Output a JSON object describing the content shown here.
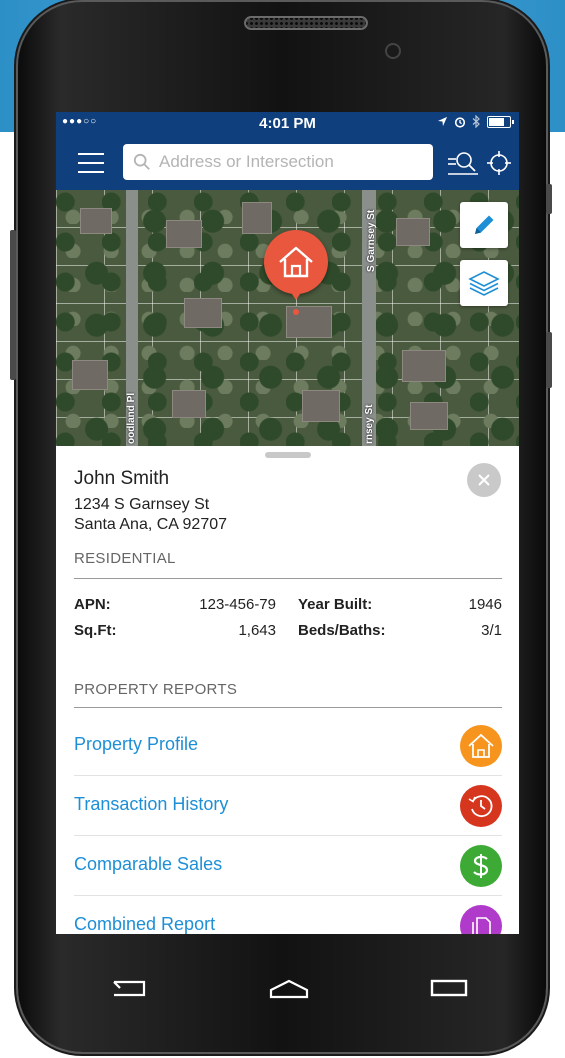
{
  "status_bar": {
    "signal": "●●●○○",
    "time": "4:01 PM",
    "icons": [
      "location-arrow-icon",
      "alarm-icon",
      "bluetooth-icon",
      "battery-icon"
    ]
  },
  "navbar": {
    "search_placeholder": "Address or Intersection",
    "icons": [
      "menu-icon",
      "search-area-icon",
      "locate-icon"
    ]
  },
  "map": {
    "streets": [
      "S Garnsey St",
      "oodland Pl",
      "rnsey St"
    ],
    "buttons": [
      "edit-pencil-icon",
      "layers-icon"
    ],
    "pin_icon": "house-icon"
  },
  "property": {
    "owner": "John Smith",
    "address_line1": "1234 S Garnsey St",
    "address_line2": "Santa Ana, CA 92707",
    "type": "RESIDENTIAL",
    "apn_label": "APN:",
    "apn": "123-456-79",
    "year_label": "Year Built:",
    "year": "1946",
    "sqft_label": "Sq.Ft:",
    "sqft": "1,643",
    "beds_label": "Beds/Baths:",
    "beds": "3/1"
  },
  "reports": {
    "title": "PROPERTY REPORTS",
    "items": [
      {
        "label": "Property Profile",
        "icon": "house-icon",
        "color": "#f7941d"
      },
      {
        "label": "Transaction History",
        "icon": "history-icon",
        "color": "#d7361e"
      },
      {
        "label": "Comparable Sales",
        "icon": "dollar-icon",
        "color": "#3daa35"
      },
      {
        "label": "Combined Report",
        "icon": "documents-icon",
        "color": "#b03ac9"
      }
    ]
  },
  "colors": {
    "nav_bg": "#0f3f7c",
    "link": "#1e8fd6",
    "pin": "#e9573f"
  }
}
